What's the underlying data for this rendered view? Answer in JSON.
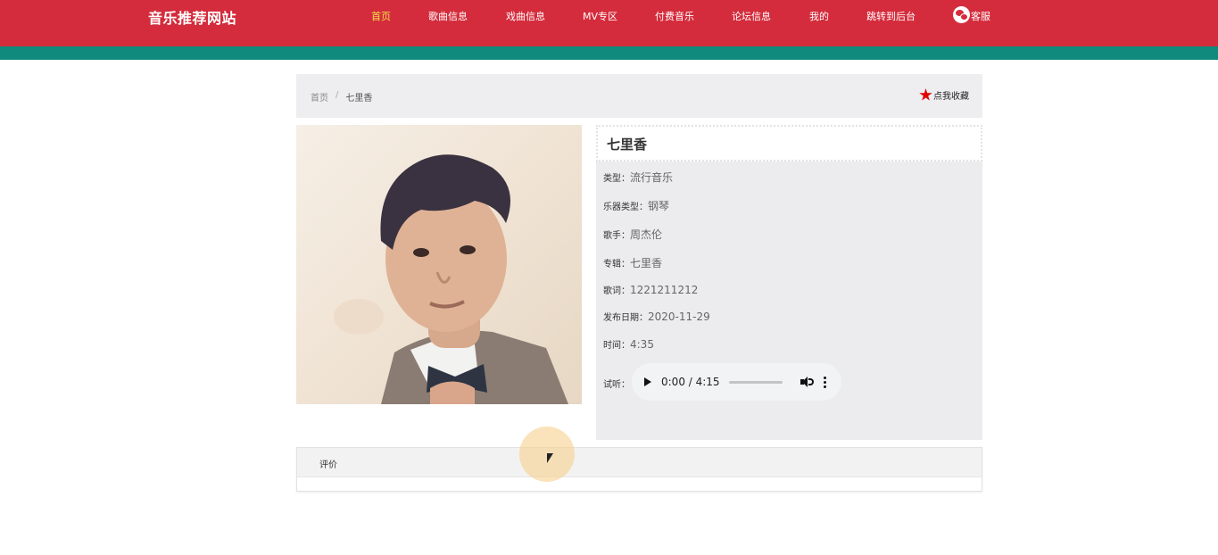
{
  "site": {
    "title": "音乐推荐网站"
  },
  "nav": {
    "items": [
      {
        "label": "首页",
        "active": true
      },
      {
        "label": "歌曲信息"
      },
      {
        "label": "戏曲信息"
      },
      {
        "label": "MV专区"
      },
      {
        "label": "付费音乐"
      },
      {
        "label": "论坛信息"
      },
      {
        "label": "我的"
      },
      {
        "label": "跳转到后台"
      }
    ],
    "customer_service": {
      "label": "客服",
      "icon": "wechat-icon"
    }
  },
  "colors": {
    "header": "#d42c3c",
    "accent_bar": "#0f8a7c",
    "active_nav": "#f5e04a",
    "star": "#e00000"
  },
  "breadcrumb": {
    "home": "首页",
    "separator": "/",
    "current": "七里香"
  },
  "favorite": {
    "label": "点我收藏",
    "icon": "star-icon"
  },
  "song": {
    "title": "七里香",
    "fields": [
      {
        "label": "类型：",
        "value": "流行音乐"
      },
      {
        "label": "乐器类型：",
        "value": "钢琴"
      },
      {
        "label": "歌手：",
        "value": "周杰伦"
      },
      {
        "label": "专辑：",
        "value": "七里香"
      },
      {
        "label": "歌词：",
        "value": "1221211212"
      },
      {
        "label": "发布日期：",
        "value": "2020-11-29"
      },
      {
        "label": "时间：",
        "value": "4:35"
      }
    ],
    "audio": {
      "label": "试听：",
      "time": "0:00 / 4:15"
    }
  },
  "review": {
    "tab_label": "评价"
  }
}
